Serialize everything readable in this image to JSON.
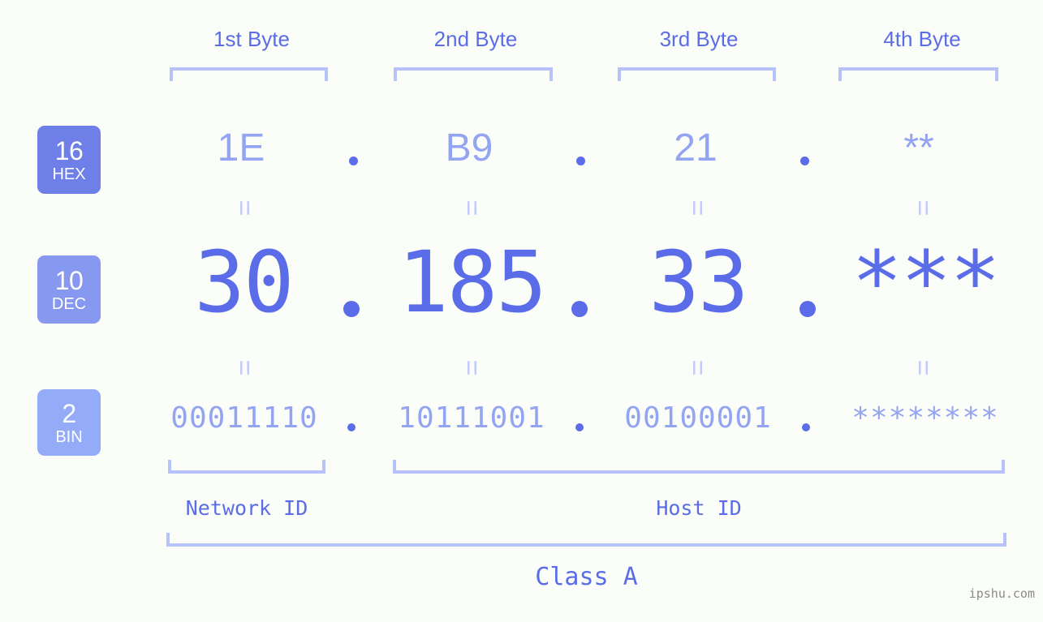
{
  "meta": {
    "background_color": "#fbfdf8",
    "accent_color": "#5b6ce8",
    "muted_accent_color": "#93a4f2",
    "bracket_color": "#b7c2fb",
    "watermark": "ipshu.com"
  },
  "byte_headers": [
    {
      "label": "1st Byte"
    },
    {
      "label": "2nd Byte"
    },
    {
      "label": "3rd Byte"
    },
    {
      "label": "4th Byte"
    }
  ],
  "radix_badges": [
    {
      "number": "16",
      "name": "HEX",
      "color": "#6e7fe8"
    },
    {
      "number": "10",
      "name": "DEC",
      "color": "#8798f0"
    },
    {
      "number": "2",
      "name": "BIN",
      "color": "#94abf7"
    }
  ],
  "rows": {
    "hex": {
      "radix": "16",
      "values": [
        "1E",
        "B9",
        "21",
        "**"
      ],
      "separator": "."
    },
    "dec": {
      "radix": "10",
      "values": [
        "30",
        "185",
        "33",
        "***"
      ],
      "separator": "."
    },
    "bin": {
      "radix": "2",
      "values": [
        "00011110",
        "10111001",
        "00100001",
        "********"
      ],
      "separator": "."
    }
  },
  "equivalence_marks": {
    "hex_to_dec": [
      "=",
      "=",
      "=",
      "="
    ],
    "dec_to_bin": [
      "=",
      "=",
      "=",
      "="
    ]
  },
  "id_sections": [
    {
      "label": "Network ID"
    },
    {
      "label": "Host ID"
    }
  ],
  "class": {
    "label": "Class A"
  }
}
